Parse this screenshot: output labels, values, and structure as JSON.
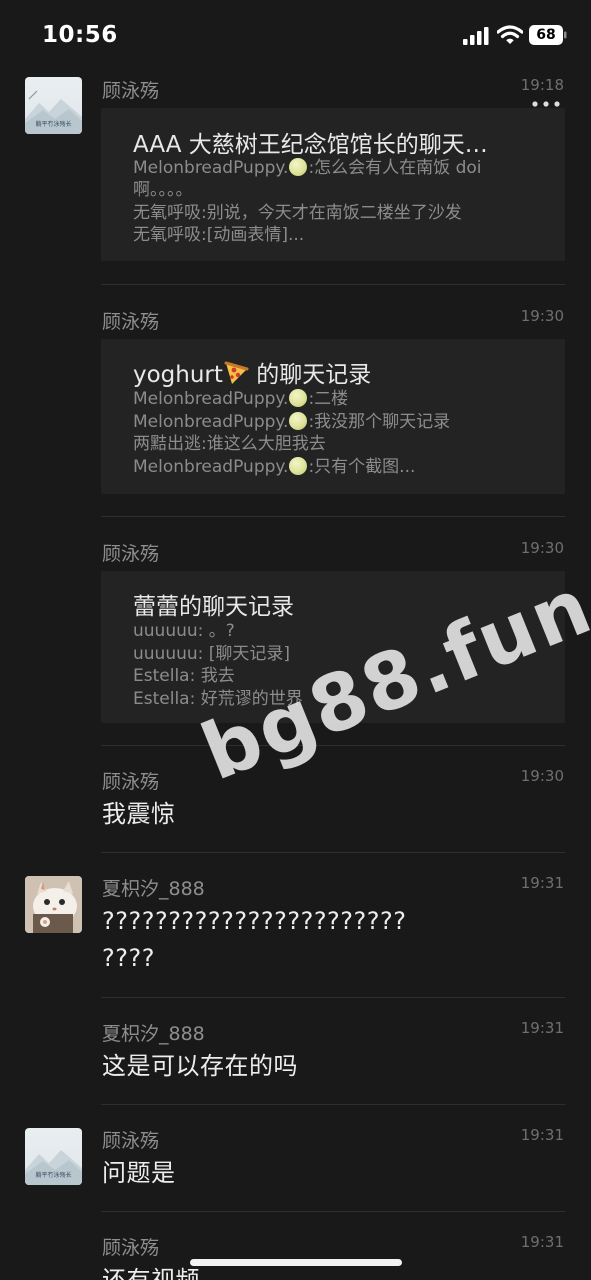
{
  "status_bar": {
    "time": "10:56",
    "battery": "68"
  },
  "messages": [
    {
      "sender": "顾泳殇",
      "time": "19:18",
      "avatar": "mountain",
      "card": {
        "title": "AAA 大慈树王纪念馆馆长的聊天…",
        "lines": [
          {
            "prefix": "MelonbreadPuppy.",
            "melon": true,
            "text": ":怎么会有人在南饭 doi"
          },
          {
            "prefix": "",
            "melon": false,
            "text": "啊。。。。"
          },
          {
            "prefix": "",
            "melon": false,
            "text": "无氧呼吸:别说，今天才在南饭二楼坐了沙发"
          },
          {
            "prefix": "",
            "melon": false,
            "text": "无氧呼吸:[动画表情]..."
          }
        ]
      }
    },
    {
      "sender": "顾泳殇",
      "time": "19:30",
      "card": {
        "title_prefix": "yoghurt",
        "title_icon": "pizza-icon",
        "title_suffix": " 的聊天记录",
        "lines": [
          {
            "prefix": "MelonbreadPuppy.",
            "melon": true,
            "text": ":二楼"
          },
          {
            "prefix": "MelonbreadPuppy.",
            "melon": true,
            "text": ":我没那个聊天记录"
          },
          {
            "prefix": "",
            "melon": false,
            "text": "两黠出逃:谁这么大胆我去"
          },
          {
            "prefix": "MelonbreadPuppy.",
            "melon": true,
            "text": ":只有个截图..."
          }
        ]
      }
    },
    {
      "sender": "顾泳殇",
      "time": "19:30",
      "card": {
        "title": "蕾蕾的聊天记录",
        "lines": [
          {
            "prefix": "",
            "melon": false,
            "text": "uuuuuu: 。?"
          },
          {
            "prefix": "",
            "melon": false,
            "text": "uuuuuu: [聊天记录]"
          },
          {
            "prefix": "",
            "melon": false,
            "text": "Estella: 我去"
          },
          {
            "prefix": "",
            "melon": false,
            "text": "Estella: 好荒谬的世界"
          }
        ]
      }
    },
    {
      "sender": "顾泳殇",
      "time": "19:30",
      "text": "我震惊"
    },
    {
      "sender": "夏枳汐_888",
      "time": "19:31",
      "avatar": "cat",
      "text_lines": [
        "???????????????????????",
        "????"
      ]
    },
    {
      "sender": "夏枳汐_888",
      "time": "19:31",
      "text": "这是可以存在的吗"
    },
    {
      "sender": "顾泳殇",
      "time": "19:31",
      "avatar": "mountain",
      "text": "问题是"
    },
    {
      "sender": "顾泳殇",
      "time": "19:31",
      "text": "还有视频"
    }
  ],
  "avatar_caption": "躺平冇泳殇长",
  "watermark": "bg88.fun",
  "icons": {
    "signal": "cellular-signal-icon",
    "wifi": "wifi-icon",
    "battery": "battery-icon",
    "more": "more-dots-icon",
    "melon": "melon-emoji-icon",
    "pizza": "pizza-emoji-icon"
  },
  "colors": {
    "background": "#191919",
    "card": "#232323",
    "name": "#8e8e8e",
    "text": "#ededed"
  }
}
